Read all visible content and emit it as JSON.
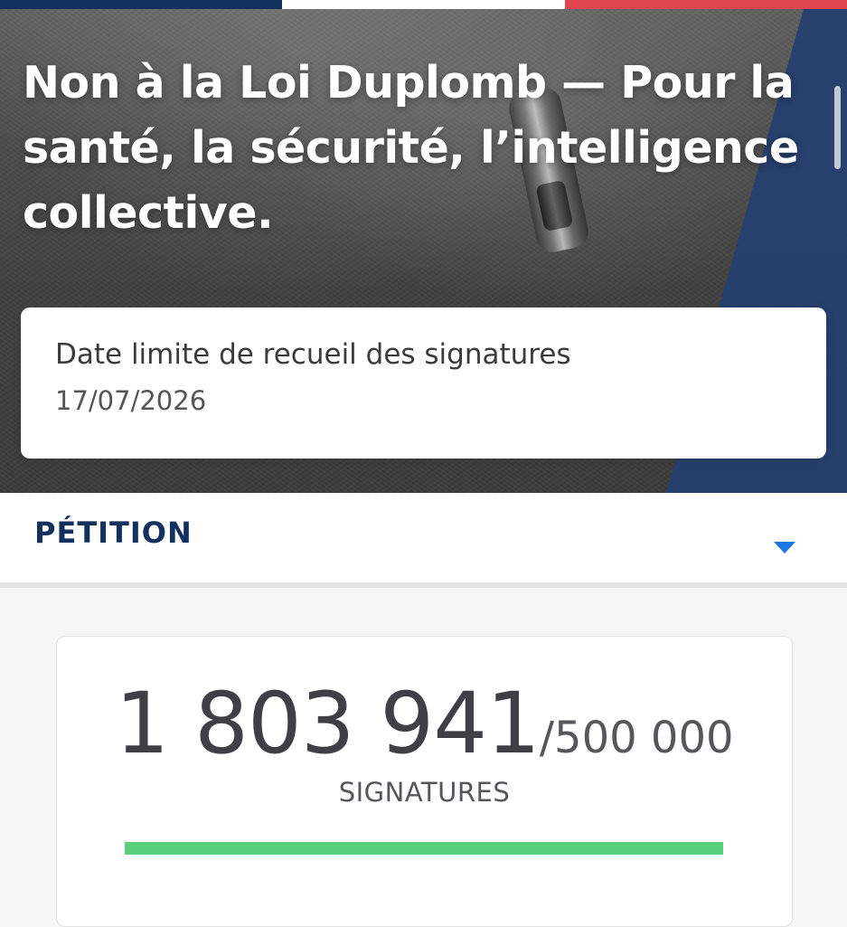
{
  "hero": {
    "title": "Non à la Loi Duplomb — Pour la santé, la sécurité, l’intelligence collective."
  },
  "deadline": {
    "label": "Date limite de recueil des signatures",
    "date": "17/07/2026"
  },
  "petition": {
    "section_label": "PÉTITION",
    "icon": "chevron-down-icon"
  },
  "signatures": {
    "count": "1 803 941",
    "goal": "/500 000",
    "label": "SIGNATURES",
    "progress_fraction": 1
  },
  "colors": {
    "primary_blue": "#12315f",
    "accent_blue": "#1a78de",
    "flag_red": "#e1464f",
    "progress_green": "#58d07e"
  }
}
